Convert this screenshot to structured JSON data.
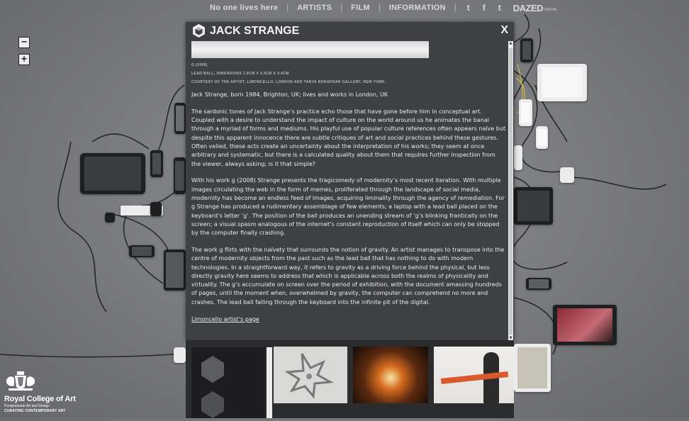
{
  "nav": {
    "items": [
      "No one lives here",
      "ARTISTS",
      "FILM",
      "INFORMATION"
    ],
    "separator": "|",
    "social": [
      {
        "name": "tumblr-icon",
        "glyph": "t"
      },
      {
        "name": "facebook-icon",
        "glyph": "f"
      },
      {
        "name": "twitter-icon",
        "glyph": "t"
      }
    ],
    "brand": "DAZED",
    "brand_sub": "DIGITAL"
  },
  "zoom": {
    "out": "−",
    "in": "+"
  },
  "modal": {
    "title": "JACK STRANGE",
    "close": "X",
    "caption_title": "G (2008)",
    "caption_materials": "LEAD BALL, DIMENSIONS 2.8CM X 4.4CM X 4.4CM",
    "caption_credit": "COURTESY OF THE ARTIST, LIMONCELLO, LONDON AND TANYA BONAKDAR GALLERY, NEW YORK.",
    "paragraphs": [
      "Jack Strange, born 1984, Brighton, UK; lives and works in London, UK",
      "The sardonic tones of Jack Strange’s practice echo those that have gone before him in conceptual art. Coupled with a desire to understand the impact of culture on the world around us he animates the banal through a myriad of forms and mediums. His playful use of popular culture references often appears naïve but despite this apparent innocence there are subtle critiques of art and social practices behind these gestures. Often veiled, these acts create an uncertainty about the interpretation of his works; they seem at once arbitrary and systematic, but there is a calculated quality about them that requires further inspection from the viewer, always asking; is it that simple?",
      "With his work g (2008) Strange presents the tragicomedy of modernity’s most recent iteration. With multiple images circulating the web in the form of memes, proliferated through the landscape of social media, modernity has become an endless feed of images, acquiring liminality through the agency of remediation. For g Strange has produced a rudimentary assemblage of few elements; a laptop with a lead ball placed on the keyboard’s letter ‘g’. The position of the ball produces an unending stream of ‘g’s blinking frantically on the screen; a visual spasm analogous of the internet’s constant reproduction of itself which can only be stopped by the computer finally crashing.",
      "The work g flirts with the naïvety that surrounds the notion of gravity. An artist manages to transpose into the centre of modernity objects from the past such as the lead ball that has nothing to do with modern technologies. In a straightforward way, it refers to gravity as a driving force behind the physical, but less directly gravity here seems to address that which is applicable across both the realms of physicality and virtuality. The g’s accumulate on screen over the period of exhibition, with the document amassing hundreds of pages, until the moment when, overwhelmed by gravity, the computer can comprehend no more and crashes. The lead ball falling through the keyboard into the infinite pit of the digital."
    ],
    "link": "Limoncello artist’s page"
  },
  "footer_logo": {
    "name": "Royal College of Art",
    "sub": "Postgraduate Art and Design",
    "sub2": "CURATING CONTEMPORARY ART"
  },
  "colors": {
    "background": "#7c7d80",
    "modal": "#3f4043",
    "text": "#ececec",
    "strip": "#2b2c2e"
  }
}
